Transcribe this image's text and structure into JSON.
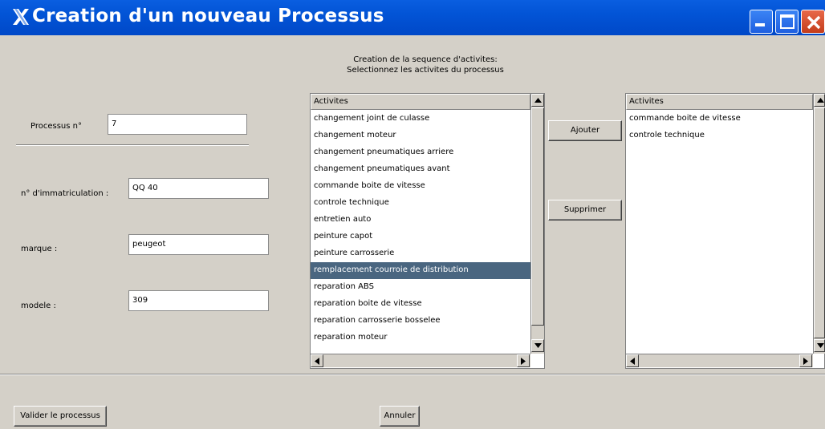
{
  "window": {
    "title": "Creation d'un nouveau Processus"
  },
  "instructions": {
    "line1": "Creation de la sequence d'activites:",
    "line2": "Selectionnez les activites du processus"
  },
  "form": {
    "processus_label": "Processus n°",
    "processus_value": "7",
    "immatriculation_label": "n° d'immatriculation :",
    "immatriculation_value": "QQ 40",
    "marque_label": "marque :",
    "marque_value": "peugeot",
    "modele_label": "modele :",
    "modele_value": "309"
  },
  "available_list": {
    "header": "Activites",
    "items": [
      "changement joint de culasse",
      "changement moteur",
      "changement pneumatiques arriere",
      "changement pneumatiques avant",
      "commande boite de vitesse",
      "controle technique",
      "entretien auto",
      "peinture capot",
      "peinture carrosserie",
      "remplacement courroie de distribution",
      "reparation ABS",
      "reparation boite de vitesse",
      "reparation carrosserie bosselee",
      "reparation moteur"
    ],
    "selected_index": 9
  },
  "selected_list": {
    "header": "Activites",
    "items": [
      "commande boite de vitesse",
      "controle technique"
    ]
  },
  "buttons": {
    "add": "Ajouter",
    "remove": "Supprimer",
    "validate": "Valider le processus",
    "cancel": "Annuler"
  },
  "icons": {
    "title_icon": "x-logo-icon",
    "minimize": "minimize-icon",
    "maximize": "maximize-icon",
    "close": "close-icon"
  },
  "colors": {
    "titlebar": "#0254d6",
    "selection": "#4a6680",
    "window_bg": "#d4d0c8",
    "close_button": "#c43d1b"
  }
}
